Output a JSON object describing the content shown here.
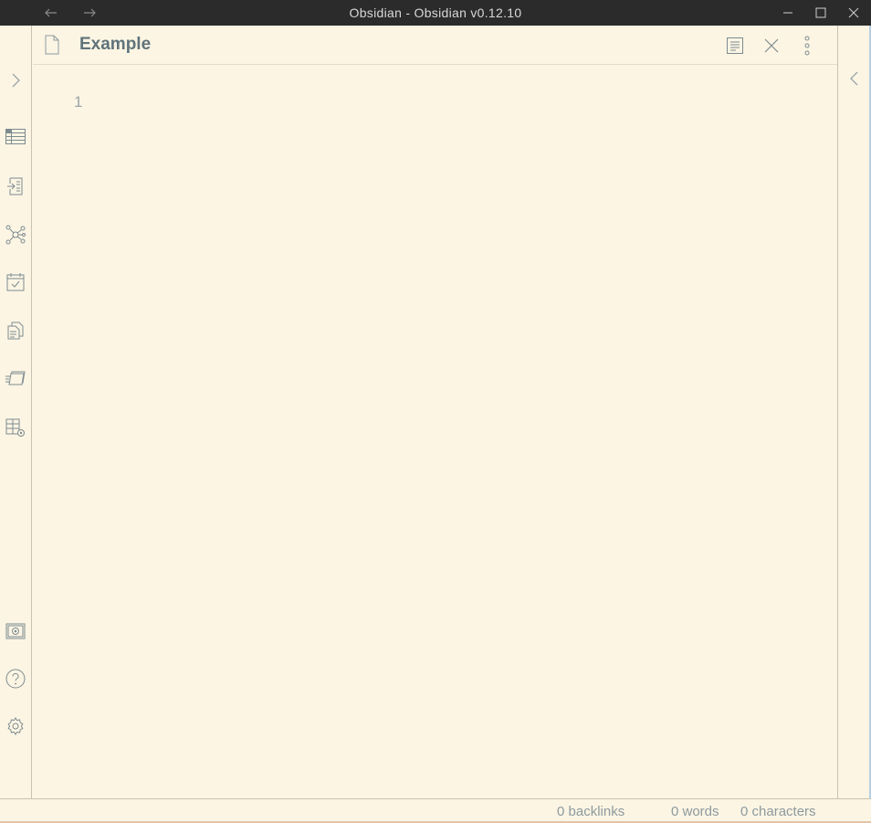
{
  "window": {
    "title": "Obsidian - Obsidian v0.12.10",
    "back_icon": "arrow-left-icon",
    "forward_icon": "arrow-right-icon"
  },
  "left_ribbon": {
    "items": [
      {
        "icon": "chevron-right-icon"
      },
      {
        "icon": "table-icon"
      },
      {
        "icon": "import-icon"
      },
      {
        "icon": "graph-icon"
      },
      {
        "icon": "calendar-check-icon"
      },
      {
        "icon": "documents-icon"
      },
      {
        "icon": "slides-icon"
      },
      {
        "icon": "table-settings-icon"
      },
      {
        "icon": "vault-icon"
      },
      {
        "icon": "help-icon"
      },
      {
        "icon": "settings-icon"
      }
    ]
  },
  "pane": {
    "title": "Example",
    "file_icon": "file-icon",
    "actions": [
      "preview-icon",
      "close-icon",
      "more-options-icon"
    ]
  },
  "editor": {
    "line_number": "1",
    "content": ""
  },
  "status_bar": {
    "backlinks": "0 backlinks",
    "words": "0 words",
    "characters": "0 characters"
  },
  "colors": {
    "background": "#fcf5e4",
    "titlebar": "#2b2b2b",
    "text": "#586e75",
    "muted": "#8d9a9e",
    "border": "#c9c2b0"
  }
}
